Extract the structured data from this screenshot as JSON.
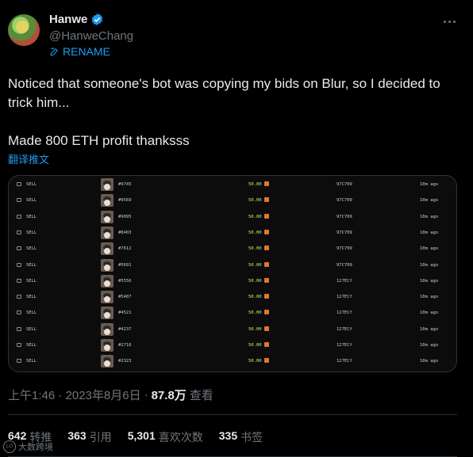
{
  "author": {
    "display_name": "Hanwe",
    "handle": "@HanweChang",
    "rename_label": "RENAME"
  },
  "tweet": {
    "line1": "Noticed that someone's bot was copying my bids on Blur, so I decided to trick him...",
    "line2": "Made 800 ETH profit thanksss",
    "translate_label": "翻译推文"
  },
  "media": {
    "rows": [
      {
        "event": "SELL",
        "token": "#9745",
        "price": "50.00",
        "addr": "97C709",
        "time": "10m ago"
      },
      {
        "event": "SELL",
        "token": "#9569",
        "price": "50.00",
        "addr": "97C709",
        "time": "10m ago"
      },
      {
        "event": "SELL",
        "token": "#9095",
        "price": "50.00",
        "addr": "97C709",
        "time": "10m ago"
      },
      {
        "event": "SELL",
        "token": "#8403",
        "price": "50.00",
        "addr": "97C709",
        "time": "10m ago"
      },
      {
        "event": "SELL",
        "token": "#7612",
        "price": "50.00",
        "addr": "97C709",
        "time": "10m ago"
      },
      {
        "event": "SELL",
        "token": "#5691",
        "price": "50.00",
        "addr": "97C709",
        "time": "10m ago"
      },
      {
        "event": "SELL",
        "token": "#5556",
        "price": "50.00",
        "addr": "127ECf",
        "time": "10m ago"
      },
      {
        "event": "SELL",
        "token": "#5407",
        "price": "50.00",
        "addr": "127ECf",
        "time": "10m ago"
      },
      {
        "event": "SELL",
        "token": "#4521",
        "price": "50.00",
        "addr": "127ECf",
        "time": "10m ago"
      },
      {
        "event": "SELL",
        "token": "#4237",
        "price": "50.00",
        "addr": "127ECf",
        "time": "10m ago"
      },
      {
        "event": "SELL",
        "token": "#2716",
        "price": "50.00",
        "addr": "127ECf",
        "time": "10m ago"
      },
      {
        "event": "SELL",
        "token": "#2323",
        "price": "50.00",
        "addr": "127ECf",
        "time": "10m ago"
      }
    ]
  },
  "meta": {
    "time": "上午1:46 · 2023年8月6日",
    "sep": "·",
    "views": "87.8万",
    "views_label": "查看"
  },
  "stats": [
    {
      "num": "642",
      "label": "转推"
    },
    {
      "num": "363",
      "label": "引用"
    },
    {
      "num": "5,301",
      "label": "喜欢次数"
    },
    {
      "num": "335",
      "label": "书签"
    }
  ],
  "watermark": {
    "logo_text": "LO",
    "text": "大数跨境"
  },
  "colors": {
    "accent": "#1d9bf0",
    "price": "#c7f26a",
    "muted": "#71767b"
  }
}
